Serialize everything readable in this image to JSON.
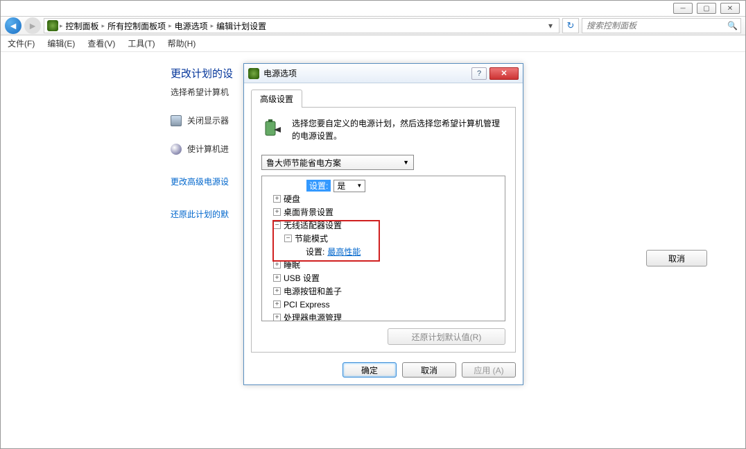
{
  "breadcrumb": {
    "items": [
      "控制面板",
      "所有控制面板项",
      "电源选项",
      "编辑计划设置"
    ]
  },
  "search": {
    "placeholder": "搜索控制面板"
  },
  "menu": {
    "file": "文件(F)",
    "edit": "编辑(E)",
    "view": "查看(V)",
    "tools": "工具(T)",
    "help": "帮助(H)"
  },
  "page": {
    "title": "更改计划的设",
    "subtitle": "选择希望计算机",
    "opt_display": "关闭显示器",
    "opt_sleep": "使计算机进",
    "link_advanced": "更改高级电源设",
    "link_restore": "还原此计划的默"
  },
  "underlay": {
    "cancel": "取消"
  },
  "dialog": {
    "title": "电源选项",
    "tab": "高级设置",
    "description": "选择您要自定义的电源计划，然后选择您希望计算机管理的电源设置。",
    "plan": "鲁大师节能省电方案",
    "tree": {
      "setting_label": "设置:",
      "setting_value": "是",
      "hdd": "硬盘",
      "desktop_bg": "桌面背景设置",
      "wireless": "无线适配器设置",
      "power_mode": "节能模式",
      "power_mode_setting_label": "设置:",
      "power_mode_setting_value": "最高性能",
      "sleep": "睡眠",
      "usb": "USB 设置",
      "power_button": "电源按钮和盖子",
      "pci": "PCI Express",
      "cpu": "处理器电源管理"
    },
    "restore_defaults": "还原计划默认值(R)",
    "ok": "确定",
    "cancel": "取消",
    "apply": "应用 (A)"
  }
}
